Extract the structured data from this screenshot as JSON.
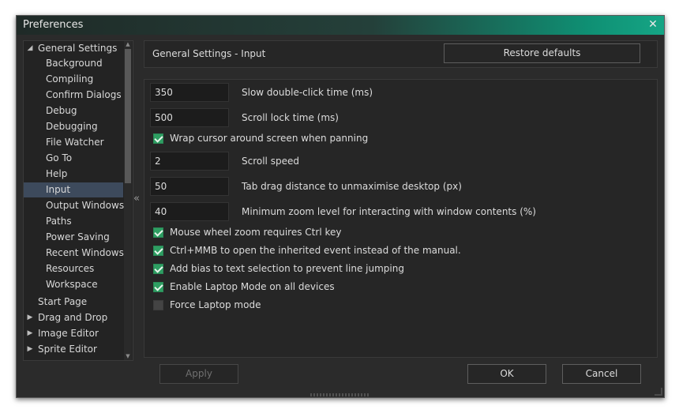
{
  "window": {
    "title": "Preferences",
    "close_glyph": "✕"
  },
  "tree": {
    "items": [
      {
        "label": "General Settings",
        "expanded": true,
        "level": 0,
        "arrow": "◢"
      },
      {
        "label": "Background",
        "level": 1
      },
      {
        "label": "Compiling",
        "level": 1
      },
      {
        "label": "Confirm Dialogs",
        "level": 1
      },
      {
        "label": "Debug",
        "level": 1
      },
      {
        "label": "Debugging",
        "level": 1
      },
      {
        "label": "File Watcher",
        "level": 1
      },
      {
        "label": "Go To",
        "level": 1
      },
      {
        "label": "Help",
        "level": 1
      },
      {
        "label": "Input",
        "level": 1,
        "selected": true
      },
      {
        "label": "Output Windows",
        "level": 1
      },
      {
        "label": "Paths",
        "level": 1
      },
      {
        "label": "Power Saving",
        "level": 1
      },
      {
        "label": "Recent Windows",
        "level": 1
      },
      {
        "label": "Resources",
        "level": 1
      },
      {
        "label": "Workspace",
        "level": 1
      },
      {
        "label": "Start Page",
        "level": 0
      },
      {
        "label": "Drag and Drop",
        "level": 0,
        "arrow": "▶"
      },
      {
        "label": "Image Editor",
        "level": 0,
        "arrow": "▶"
      },
      {
        "label": "Sprite Editor",
        "level": 0,
        "arrow": "▶"
      }
    ],
    "collapse_glyph": "«"
  },
  "header": {
    "title": "General Settings - Input",
    "restore_label": "Restore defaults"
  },
  "settings": {
    "slow_double_click": {
      "value": "350",
      "label": "Slow double-click time (ms)"
    },
    "scroll_lock": {
      "value": "500",
      "label": "Scroll lock time (ms)"
    },
    "wrap_cursor": {
      "checked": true,
      "label": "Wrap cursor around screen when panning"
    },
    "scroll_speed": {
      "value": "2",
      "label": "Scroll speed"
    },
    "tab_drag": {
      "value": "50",
      "label": "Tab drag distance to unmaximise desktop (px)"
    },
    "min_zoom": {
      "value": "40",
      "label": "Minimum zoom level for interacting with window contents (%)"
    },
    "wheel_zoom_ctrl": {
      "checked": true,
      "label": "Mouse wheel zoom requires Ctrl key"
    },
    "ctrl_mmb": {
      "checked": true,
      "label": "Ctrl+MMB to open the inherited event instead of the manual."
    },
    "add_bias": {
      "checked": true,
      "label": "Add bias to text selection to prevent line jumping"
    },
    "laptop_mode_all": {
      "checked": true,
      "label": "Enable Laptop Mode on all devices"
    },
    "force_laptop": {
      "checked": false,
      "label": "Force Laptop mode"
    }
  },
  "footer": {
    "apply_label": "Apply",
    "ok_label": "OK",
    "cancel_label": "Cancel"
  },
  "colors": {
    "accent_green": "#2e9e62",
    "selection": "#3d4a5c",
    "title_gradient_end": "#15a585"
  }
}
